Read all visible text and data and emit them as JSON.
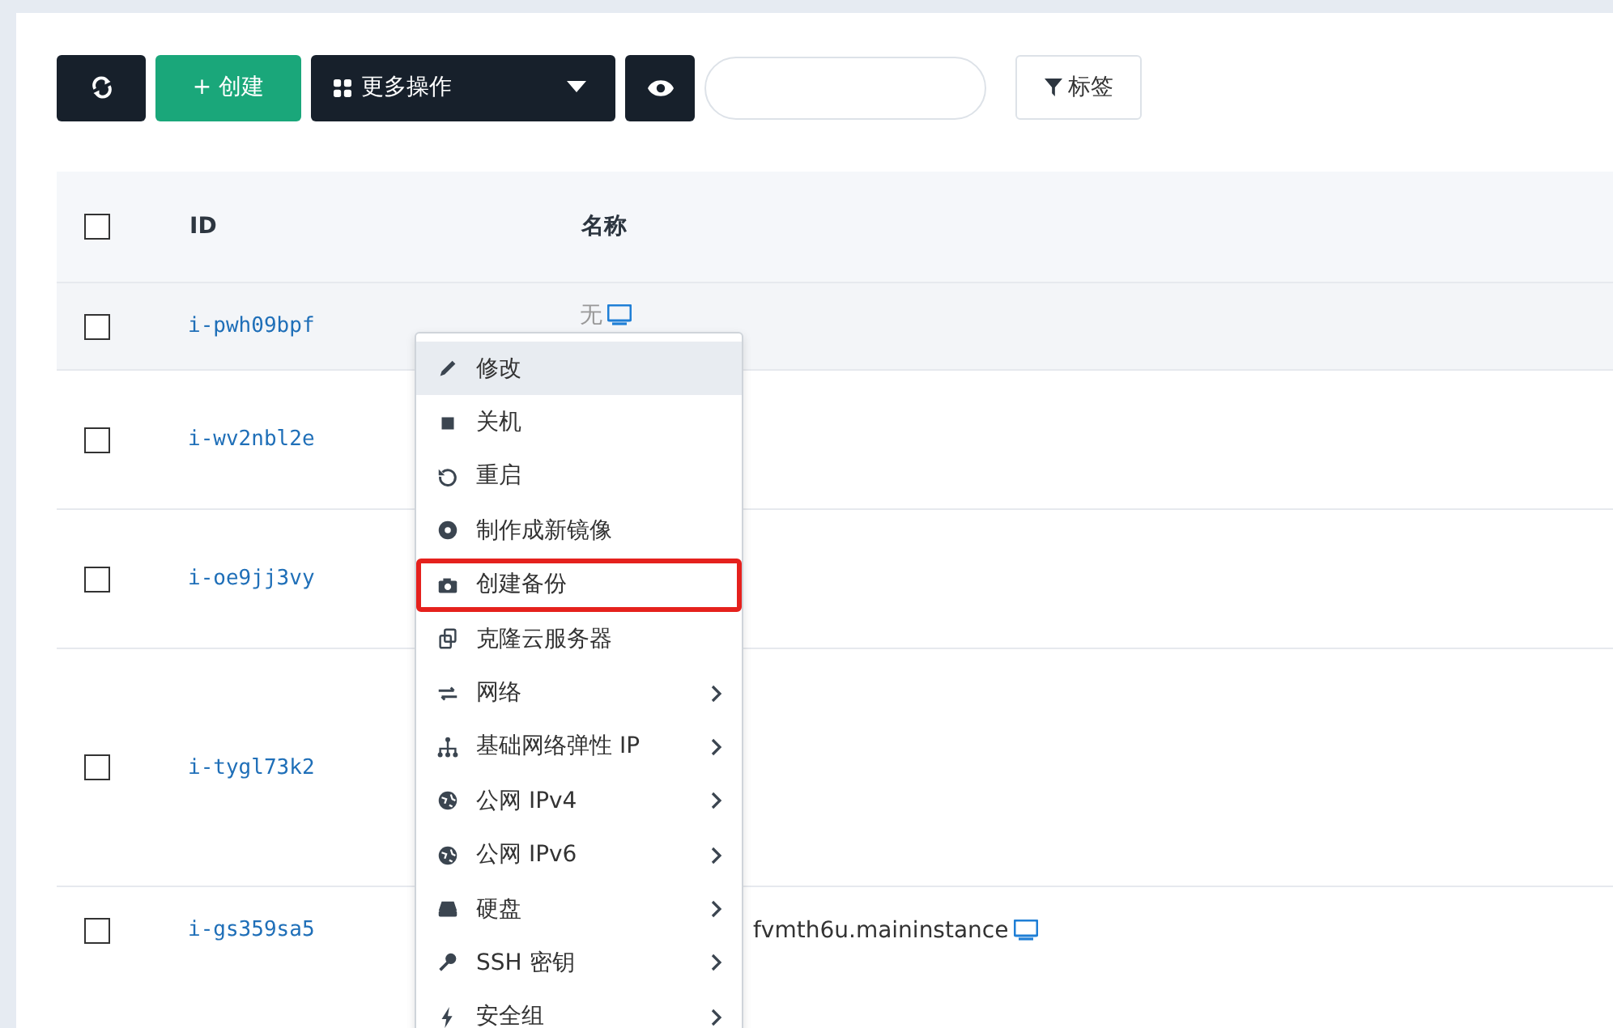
{
  "toolbar": {
    "create_label": "+ 创建",
    "more_label": "更多操作",
    "tag_label": "标签"
  },
  "table": {
    "all_checked": false,
    "columns": [
      "ID",
      "名称"
    ],
    "rows": [
      {
        "id": "i-pwh09bpf",
        "name": "无",
        "checked": false,
        "hovered": true
      },
      {
        "id": "i-wv2nbl2e",
        "checked": false,
        "hovered": false
      },
      {
        "id": "i-oe9jj3vy",
        "checked": false,
        "hovered": false
      },
      {
        "id": "i-tygl73k2",
        "checked": false,
        "hovered": false
      },
      {
        "id": "i-gs359sa5",
        "name": "fvmth6u.maininstance",
        "checked": false,
        "hovered": false
      }
    ]
  },
  "context_menu": {
    "items": [
      {
        "label": "修改",
        "selected": true,
        "submenu": false,
        "outlined": false
      },
      {
        "label": "关机",
        "selected": false,
        "submenu": false,
        "outlined": false
      },
      {
        "label": "重启",
        "selected": false,
        "submenu": false,
        "outlined": false
      },
      {
        "label": "制作成新镜像",
        "selected": false,
        "submenu": false,
        "outlined": false
      },
      {
        "label": "创建备份",
        "selected": false,
        "submenu": false,
        "outlined": true
      },
      {
        "label": "克隆云服务器",
        "selected": false,
        "submenu": false,
        "outlined": false
      },
      {
        "label": "网络",
        "selected": false,
        "submenu": true,
        "outlined": false
      },
      {
        "label": "基础网络弹性 IP",
        "selected": false,
        "submenu": true,
        "outlined": false
      },
      {
        "label": "公网 IPv4",
        "selected": false,
        "submenu": true,
        "outlined": false
      },
      {
        "label": "公网 IPv6",
        "selected": false,
        "submenu": true,
        "outlined": false
      },
      {
        "label": "硬盘",
        "selected": false,
        "submenu": true,
        "outlined": false
      },
      {
        "label": "SSH 密钥",
        "selected": false,
        "submenu": true,
        "outlined": false
      },
      {
        "label": "安全组",
        "selected": false,
        "submenu": true,
        "outlined": false
      }
    ]
  }
}
